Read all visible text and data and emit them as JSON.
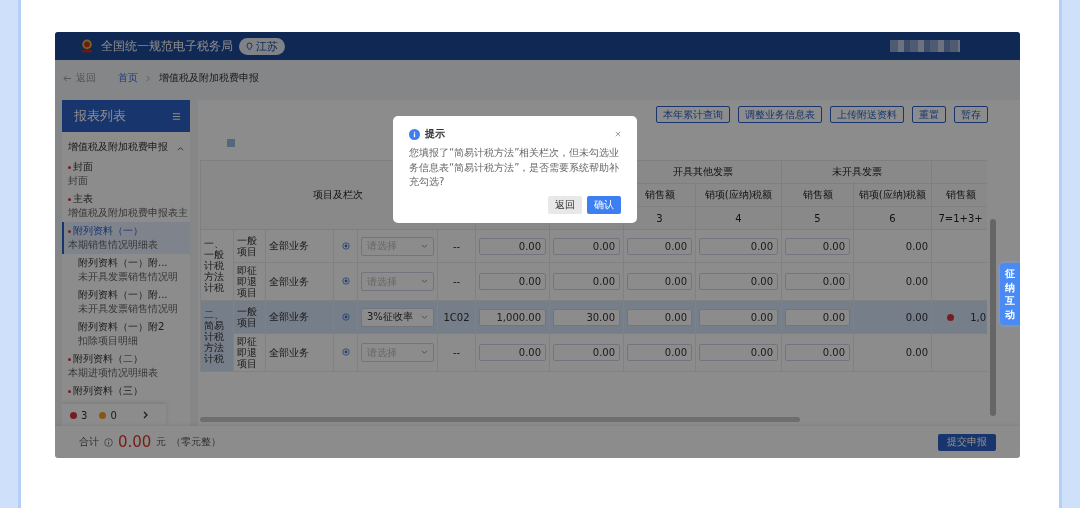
{
  "header": {
    "title": "全国统一规范电子税务局",
    "region": "江苏"
  },
  "breadcrumb": {
    "back": "返回",
    "items": [
      "首页",
      "增值税及附加税费申报"
    ]
  },
  "sidebar": {
    "title": "报表列表",
    "group": {
      "label": "增值税及附加税费申报",
      "expanded": true
    },
    "items": [
      {
        "title": "封面",
        "subtitle": "封面",
        "required": true,
        "selected": false
      },
      {
        "title": "主表",
        "subtitle": "增值税及附加税费申报表主",
        "required": true,
        "selected": false
      },
      {
        "title": "附列资料（一）",
        "subtitle": "本期销售情况明细表",
        "required": true,
        "selected": true,
        "children": [
          {
            "title": "附列资料（一）附...",
            "subtitle": "未开具发票销售情况明"
          },
          {
            "title": "附列资料（一）附...",
            "subtitle": "未开具发票销售情况明"
          },
          {
            "title": "附列资料（一）附2",
            "subtitle": "扣除项目明细"
          }
        ]
      },
      {
        "title": "附列资料（二）",
        "subtitle": "本期进项情况明细表",
        "required": true,
        "selected": false
      },
      {
        "title": "附列资料（三）",
        "required": true,
        "selected": false
      }
    ],
    "errors": "3",
    "warnings": "0"
  },
  "toolbar_buttons": [
    "本年累计查询",
    "调整业务信息表",
    "上传附送资料",
    "重置",
    "暂存"
  ],
  "table": {
    "header": "项目及栏次",
    "column_groups": [
      "开具其他发票",
      "未开具发票"
    ],
    "sub_headers": [
      "销售额",
      "销项(应纳)税额",
      "销售额",
      "销项(应纳)税额",
      "销售额"
    ],
    "numbers": [
      "3",
      "4",
      "5",
      "6",
      "7=1+3+"
    ],
    "groups": [
      {
        "label": "一、一般计税方法计税",
        "selected": false,
        "rows": [
          {
            "item": "一般项目",
            "business": "全部业务",
            "select": {
              "placeholder": "请选择"
            },
            "code": "--",
            "inputs": [
              "0.00",
              "0.00",
              "0.00",
              "0.00",
              "0.00"
            ],
            "amount_6": "0.00",
            "selected": false,
            "error": false
          },
          {
            "item": "即征即退项目",
            "business": "全部业务",
            "select": {
              "placeholder": "请选择"
            },
            "code": "--",
            "inputs": [
              "0.00",
              "0.00",
              "0.00",
              "0.00",
              "0.00"
            ],
            "amount_6": "0.00",
            "selected": false,
            "error": false
          }
        ]
      },
      {
        "label": "二、简易计税方法计税",
        "selected": true,
        "rows": [
          {
            "item": "一般项目",
            "business": "全部业务",
            "select": {
              "value": "3%征收率"
            },
            "code": "1C02",
            "inputs": [
              "1,000.00",
              "30.00",
              "0.00",
              "0.00",
              "0.00"
            ],
            "amount_6": "0.00",
            "amount_7": "1,0",
            "selected": true,
            "error": true
          },
          {
            "item": "即征即退项目",
            "business": "全部业务",
            "select": {
              "placeholder": "请选择"
            },
            "code": "--",
            "inputs": [
              "0.00",
              "0.00",
              "0.00",
              "0.00",
              "0.00"
            ],
            "amount_6": "0.00",
            "selected": false,
            "error": false
          }
        ]
      }
    ]
  },
  "footer": {
    "label": "合计",
    "amount": "0.00",
    "unit": "元",
    "words": "（零元整）",
    "submit": "提交申报"
  },
  "side_tab": "征纳互动",
  "dialog": {
    "title": "提示",
    "message": "您填报了“简易计税方法”相关栏次，但未勾选业务信息表“简易计税方法”，是否需要系统帮助补充勾选?",
    "buttons": [
      {
        "label": "返回",
        "kind": "secondary"
      },
      {
        "label": "确认",
        "kind": "primary"
      }
    ]
  }
}
